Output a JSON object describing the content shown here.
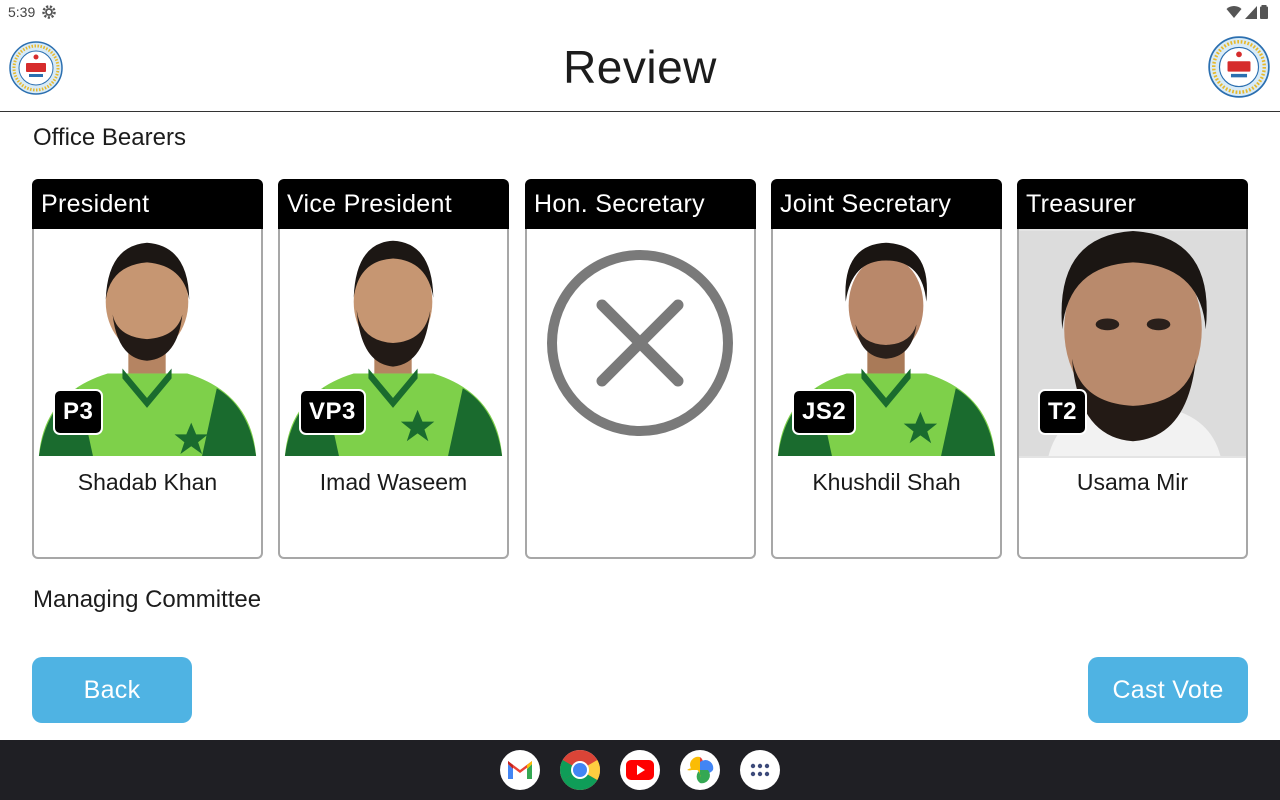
{
  "status_bar": {
    "time": "5:39"
  },
  "header": {
    "title": "Review"
  },
  "sections": {
    "office_bearers": "Office Bearers",
    "managing_committee": "Managing Committee"
  },
  "cards": [
    {
      "position": "President",
      "code": "P3",
      "name": "Shadab Khan"
    },
    {
      "position": "Vice President",
      "code": "VP3",
      "name": "Imad Waseem"
    },
    {
      "position": "Hon. Secretary",
      "code": "",
      "name": ""
    },
    {
      "position": "Joint Secretary",
      "code": "JS2",
      "name": "Khushdil Shah"
    },
    {
      "position": "Treasurer",
      "code": "T2",
      "name": "Usama Mir"
    }
  ],
  "buttons": {
    "back": "Back",
    "cast_vote": "Cast Vote"
  },
  "dock": [
    "gmail-icon",
    "chrome-icon",
    "youtube-icon",
    "photos-icon",
    "app-drawer-icon"
  ],
  "colors": {
    "accent": "#4fb3e3",
    "header_bar": "#000000",
    "jersey_green": "#7ed04a"
  }
}
